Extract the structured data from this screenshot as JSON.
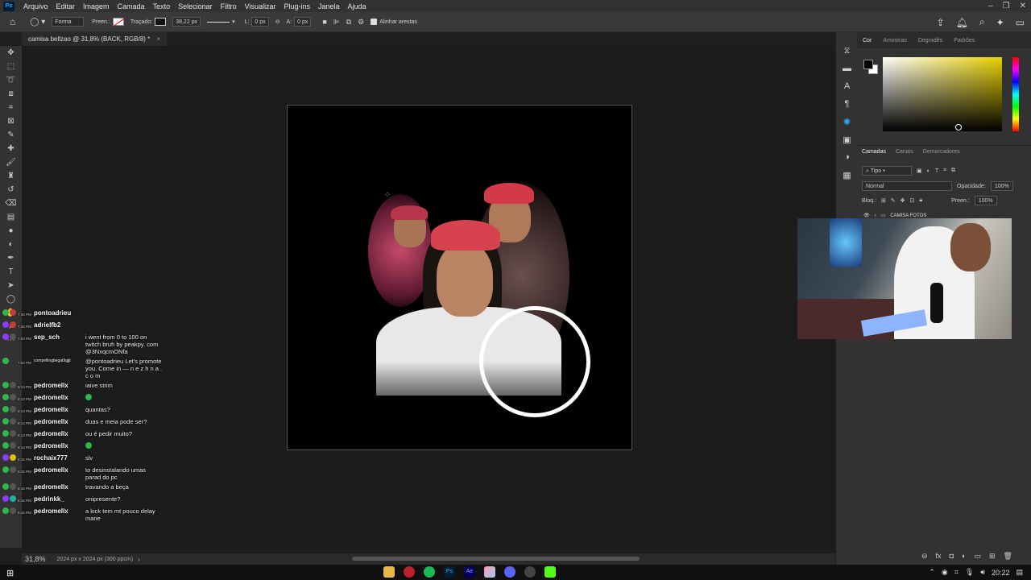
{
  "app": {
    "logo_text": "Ps"
  },
  "menu": [
    "Arquivo",
    "Editar",
    "Imagem",
    "Camada",
    "Texto",
    "Selecionar",
    "Filtro",
    "Visualizar",
    "Plug-ins",
    "Janela",
    "Ajuda"
  ],
  "options_bar": {
    "shape_mode": "Forma",
    "fill_label": "Preen.:",
    "stroke_label": "Traçado:",
    "stroke_size": "38,22 px",
    "width_label": "L:",
    "width_value": "0 px",
    "height_label": "A:",
    "height_value": "0 px",
    "align_edges": "Alinhar arestas"
  },
  "document": {
    "tab_title": "camisa bellzao @ 31,8% (BACK, RGB/8) *",
    "close_glyph": "×"
  },
  "status_bar": {
    "zoom": "31,8%",
    "dimensions": "2024 px x 2024 px (300 ppcm)"
  },
  "color_panel": {
    "tabs": [
      "Cor",
      "Amostras",
      "Degradês",
      "Padrões"
    ]
  },
  "layers_panel": {
    "tabs": [
      "Camadas",
      "Canais",
      "Demarcadores"
    ],
    "filter_kind": "Tipo",
    "blend_mode": "Normal",
    "opacity_label": "Opacidade:",
    "opacity_value": "100%",
    "lock_label": "Bloq.:",
    "fill_label": "Preen.:",
    "fill_value": "100%",
    "group_name": "CAMISA FOTOS"
  },
  "chat": [
    {
      "time": "7:46 PM",
      "user": "pontoadrieu",
      "text": ""
    },
    {
      "time": "7:46 PM",
      "user": "adrielfb2",
      "text": ""
    },
    {
      "time": "7:02 PM",
      "user": "sep_sch",
      "text": "i went from 0 to 100 on twitch bruh by peakpy. com @3NxqcmONfa"
    },
    {
      "time": "7:02 PM",
      "user": "compellingbegat9gjjt",
      "text": "@pontoadrieu Let's promote you. Come in — n e z h n a . c o m"
    },
    {
      "time": "8:13 PM",
      "user": "pedromellx",
      "text": "iaive strim"
    },
    {
      "time": "8:13 PM",
      "user": "pedromellx",
      "text": ""
    },
    {
      "time": "8:14 PM",
      "user": "pedromellx",
      "text": "quantas?"
    },
    {
      "time": "8:14 PM",
      "user": "pedromellx",
      "text": "duas e meia pode ser?"
    },
    {
      "time": "8:14 PM",
      "user": "pedromellx",
      "text": "ou é pedir muito?"
    },
    {
      "time": "8:14 PM",
      "user": "pedromellx",
      "text": ""
    },
    {
      "time": "8:15 PM",
      "user": "rochaix777",
      "text": "slv"
    },
    {
      "time": "8:15 PM",
      "user": "pedromellx",
      "text": "to desinstalando umas parad do pc"
    },
    {
      "time": "8:15 PM",
      "user": "pedromellx",
      "text": "travando a beça"
    },
    {
      "time": "8:16 PM",
      "user": "pedrinkk_",
      "text": "onipresente?"
    },
    {
      "time": "8:16 PM",
      "user": "pedromellx",
      "text": "a kick tem mt pouco delay mane"
    }
  ],
  "taskbar": {
    "app_labels": [
      "Ps",
      "Ae"
    ],
    "clock": "20:22"
  },
  "colors": {
    "accent": "#31a8ff",
    "chat_badge_green": "#2fb84a",
    "chat_badge_purple": "#8a3cff",
    "brand_red": "#d23a4a"
  }
}
